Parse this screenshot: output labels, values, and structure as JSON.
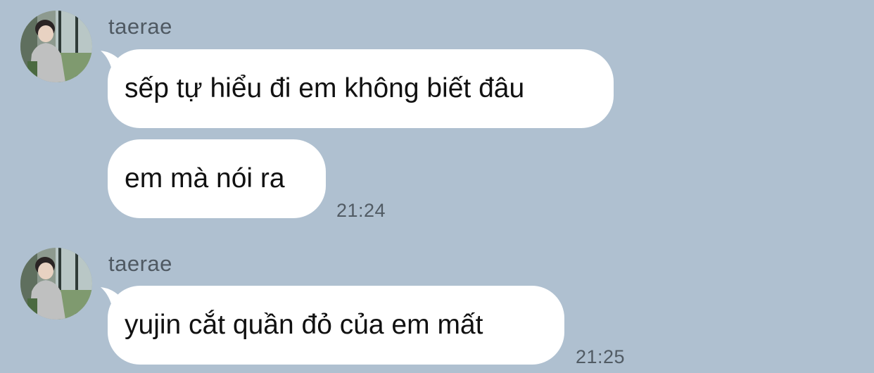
{
  "messages": [
    {
      "sender": "taerae",
      "avatar_icon": "profile-photo",
      "bubbles": [
        {
          "text": "sếp tự hiểu đi em không biết đâu"
        },
        {
          "text": "em mà nói ra"
        }
      ],
      "time": "21:24"
    },
    {
      "sender": "taerae",
      "avatar_icon": "profile-photo",
      "bubbles": [
        {
          "text": "yujin cắt quần đỏ của em mất"
        }
      ],
      "time": "21:25"
    }
  ],
  "colors": {
    "background": "#afc0d0",
    "bubble": "#ffffff",
    "sender_text": "#4f5962",
    "time_text": "#515b64"
  }
}
